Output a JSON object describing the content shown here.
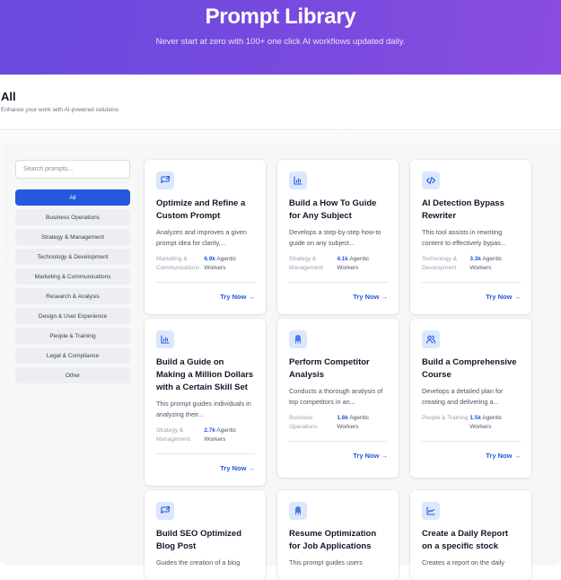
{
  "hero": {
    "title": "Prompt Library",
    "subtitle": "Never start at zero with 100+ one click AI workflows updated daily."
  },
  "page": {
    "heading": "All",
    "subheading": "Enhance your work with AI-powered solutions"
  },
  "search": {
    "placeholder": "Search prompts..."
  },
  "categories": [
    {
      "label": "All",
      "active": true
    },
    {
      "label": "Business Operations"
    },
    {
      "label": "Strategy & Management"
    },
    {
      "label": "Technology & Development"
    },
    {
      "label": "Marketing & Communications"
    },
    {
      "label": "Research & Analysis"
    },
    {
      "label": "Design & User Experience"
    },
    {
      "label": "People & Training"
    },
    {
      "label": "Legal & Compliance"
    },
    {
      "label": "Other"
    }
  ],
  "colors": {
    "accent": "#2458de",
    "hero_start": "#6a4adf",
    "hero_end": "#8a4de0",
    "icon_bg": "#dbe7fd"
  },
  "cards": [
    {
      "icon": "message-share-icon",
      "title": "Optimize and Refine a Custom Prompt",
      "description": "Analyzes and improves a given prompt idea for clarity,...",
      "category": "Marketing & Communications",
      "count": "6.9k",
      "count_suffix": "Agentic Workers",
      "cta": "Try Now →"
    },
    {
      "icon": "bar-chart-icon",
      "title": "Build a How To Guide for Any Subject",
      "description": "Develops a step-by-step how-to guide on any subject...",
      "category": "Strategy & Management",
      "count": "4.1k",
      "count_suffix": "Agentic Workers",
      "cta": "Try Now →"
    },
    {
      "icon": "code-icon",
      "title": "AI Detection Bypass Rewriter",
      "description": "This tool assists in rewriting content to effectively bypas...",
      "category": "Technology & Development",
      "count": "3.3k",
      "count_suffix": "Agentic Workers",
      "cta": "Try Now →"
    },
    {
      "icon": "bar-chart-icon",
      "title": "Build a Guide on Making a Million Dollars with a Certain Skill Set",
      "description": "This prompt guides individuals in analyzing their...",
      "category": "Strategy & Management",
      "count": "2.7k",
      "count_suffix": "Agentic Workers",
      "cta": "Try Now →"
    },
    {
      "icon": "building-icon",
      "title": "Perform Competitor Analysis",
      "description": "Conducts a thorough analysis of top competitors in an...",
      "category": "Business Operations",
      "count": "1.8k",
      "count_suffix": "Agentic Workers",
      "cta": "Try Now →"
    },
    {
      "icon": "users-icon",
      "title": "Build a Comprehensive Course",
      "description": "Develops a detailed plan for creating and delivering a...",
      "category": "People & Training",
      "count": "1.5k",
      "count_suffix": "Agentic Workers",
      "cta": "Try Now →"
    },
    {
      "icon": "message-share-icon",
      "title": "Build SEO Optimized Blog Post",
      "description": "Guides the creation of a blog",
      "category": "",
      "count": "",
      "count_suffix": "",
      "cta": ""
    },
    {
      "icon": "building-icon",
      "title": "Resume Optimization for Job Applications",
      "description": "This prompt guides users",
      "category": "",
      "count": "",
      "count_suffix": "",
      "cta": ""
    },
    {
      "icon": "line-chart-icon",
      "title": "Create a Daily Report on a specific stock",
      "description": "Creates a report on the daily",
      "category": "",
      "count": "",
      "count_suffix": "",
      "cta": ""
    }
  ]
}
